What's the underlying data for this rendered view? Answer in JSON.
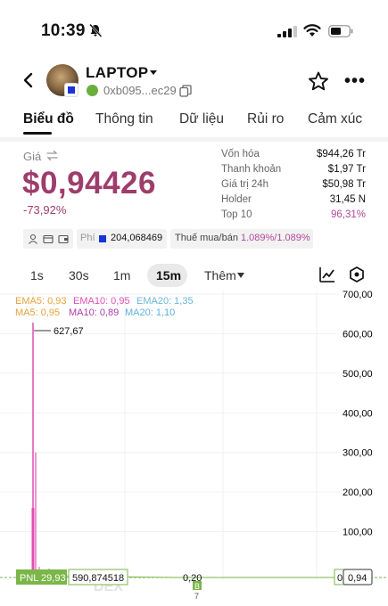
{
  "status_bar": {
    "time": "10:39"
  },
  "header": {
    "token": "LAPTOP",
    "address": "0xb095...ec29"
  },
  "tabs": [
    {
      "label": "Biểu đồ",
      "active": true
    },
    {
      "label": "Thông tin",
      "active": false
    },
    {
      "label": "Dữ liệu",
      "active": false
    },
    {
      "label": "Rủi ro",
      "active": false
    },
    {
      "label": "Cảm xúc",
      "active": false
    }
  ],
  "price": {
    "label": "Giá",
    "value": "$0,94426",
    "change": "-73,92%"
  },
  "stats": [
    {
      "label": "Vốn hóa",
      "value": "$944,26 Tr"
    },
    {
      "label": "Thanh khoản",
      "value": "$1,97 Tr"
    },
    {
      "label": "Giá trị 24h",
      "value": "$50,98 Tr"
    },
    {
      "label": "Holder",
      "value": "31,45 N"
    },
    {
      "label": "Top 10",
      "value": "96,31%"
    }
  ],
  "fees": {
    "fee_label": "Phí",
    "fee_value": "204,068469",
    "tax_label": "Thuế mua/bán",
    "tax_value": "1.089%/1.089%"
  },
  "timeframes": [
    "1s",
    "30s",
    "1m",
    "15m"
  ],
  "timeframe_active": "15m",
  "more_label": "Thêm",
  "indicators": {
    "ema5": "EMA5: 0,93",
    "ema10": "EMA10: 0,95",
    "ema20": "EMA20: 1,35",
    "ma5": "MA5: 0,95",
    "ma10": "MA10: 0,89",
    "ma20": "MA20: 1,10"
  },
  "chart_data": {
    "type": "candlestick",
    "y_axis_ticks": [
      "700,00",
      "600,00",
      "500,00",
      "400,00",
      "300,00",
      "200,00",
      "100,00"
    ],
    "ylim": [
      0,
      700
    ],
    "high_marker": "627,67",
    "current_price": "0,94",
    "current_axis_label": "0",
    "mid_label": "0,20",
    "pnl_label": "PNL 29,93",
    "pnl_value": "590,874518",
    "marker_letter": "B",
    "marker_count": "7",
    "watermark": "DEX",
    "spike_candles": [
      {
        "high": 627.67,
        "low": 0,
        "body_top": 160,
        "body_bottom": 0
      },
      {
        "high": 300,
        "low": 0,
        "body_top": 0,
        "body_bottom": 0
      }
    ],
    "colors": {
      "up": "#7ab648",
      "down": "#e14fb4",
      "ema5": "#e6a23c",
      "ema10": "#e14fb4",
      "ema20": "#6ab7d6",
      "ma5": "#e6a23c",
      "ma10": "#b03ab0",
      "ma20": "#5bb0e0"
    }
  }
}
